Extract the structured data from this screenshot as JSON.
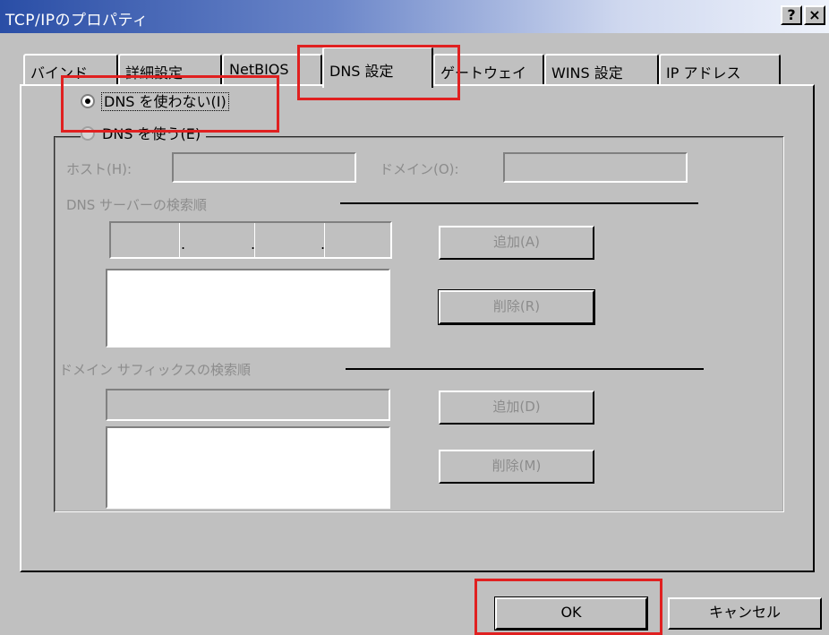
{
  "window": {
    "title": "TCP/IPのプロパティ",
    "help_glyph": "?",
    "close_glyph": "×"
  },
  "tabs": [
    {
      "label": "バインド"
    },
    {
      "label": "詳細設定"
    },
    {
      "label": "NetBIOS"
    },
    {
      "label": "DNS 設定",
      "active": true
    },
    {
      "label": "ゲートウェイ"
    },
    {
      "label": "WINS 設定"
    },
    {
      "label": "IP アドレス"
    }
  ],
  "dns": {
    "disable_label": "DNS を使わない(I)",
    "enable_label": "DNS を使う(E)",
    "selected": "disable",
    "host_label": "ホスト(H):",
    "host_value": "",
    "domain_label": "ドメイン(O):",
    "domain_value": "",
    "server_order_label": "DNS サーバーの検索順",
    "server_ip": [
      "",
      "",
      "",
      ""
    ],
    "server_ip_separator": ".",
    "server_add_label": "追加(A)",
    "server_remove_label": "削除(R)",
    "suffix_order_label": "ドメイン サフィックスの検索順",
    "suffix_value": "",
    "suffix_add_label": "追加(D)",
    "suffix_remove_label": "削除(M)"
  },
  "footer": {
    "ok_label": "OK",
    "cancel_label": "キャンセル"
  },
  "colors": {
    "title_gradient_start": "#2a4ea6",
    "dialog_face": "#c0c0c0",
    "highlight_box": "#e02020",
    "disabled_text": "#8c8c8c"
  }
}
